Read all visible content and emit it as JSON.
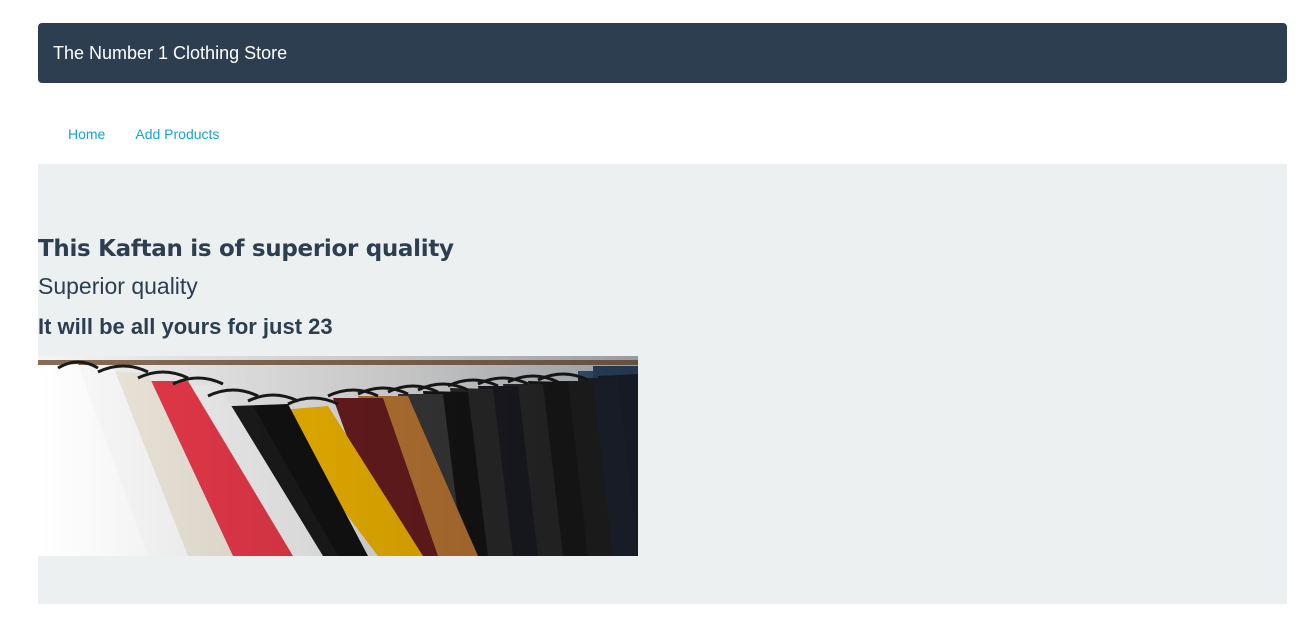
{
  "header": {
    "brand": "The Number 1 Clothing Store"
  },
  "nav": {
    "items": [
      {
        "label": "Home"
      },
      {
        "label": "Add Products"
      }
    ]
  },
  "product": {
    "title": "This Kaftan is of superior quality",
    "subtitle": "Superior quality",
    "price_text": "It will be all yours for just 23",
    "image_icon": "clothing-rack-photo"
  },
  "colors": {
    "navbar_bg": "#2c3e50",
    "link": "#18a2d6",
    "jumbotron_bg": "#ecf0f1",
    "text": "#2c3e50"
  }
}
